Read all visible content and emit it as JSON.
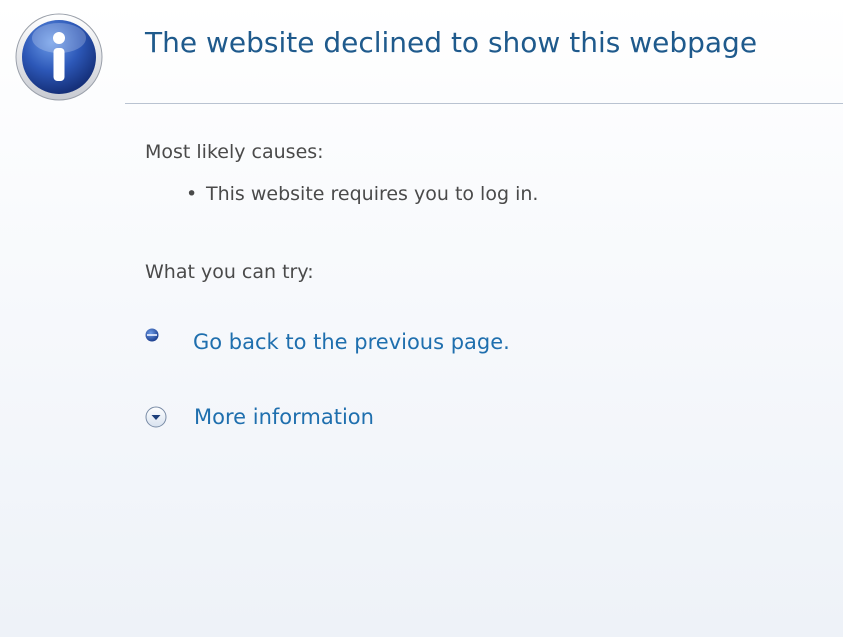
{
  "title": "The website declined to show this webpage",
  "causes": {
    "label": "Most likely causes:",
    "items": [
      {
        "bullet": "•",
        "text": "This website requires you to log in."
      }
    ]
  },
  "try": {
    "label": "What you can try:",
    "go_back": "Go back to the previous page.",
    "more_info": "More information"
  },
  "icons": {
    "header": "info-icon",
    "go_back": "bullet-dot-icon",
    "more_info": "chevron-down-circle-icon"
  },
  "colors": {
    "title": "#1f5a8c",
    "link": "#1f6fae",
    "icon_blue": "#2a4f9e"
  }
}
